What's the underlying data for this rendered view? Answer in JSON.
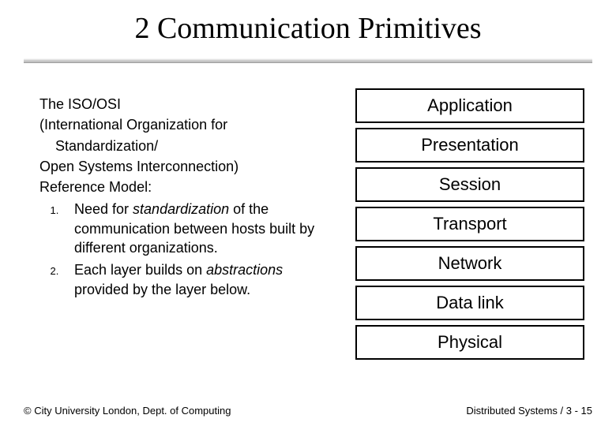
{
  "title": "2 Communication Primitives",
  "left": {
    "line1": "The ISO/OSI",
    "line2": "(International Organization for",
    "line3": "Standardization/",
    "line4": "Open Systems Interconnection)",
    "line5": "Reference Model:",
    "item1_pre": "Need for ",
    "item1_em": "standardization",
    "item1_post": " of the communication between hosts built by different organizations.",
    "item2_pre": "Each layer builds on ",
    "item2_em": "abstractions",
    "item2_post": " provided by the layer below."
  },
  "layers": {
    "l1": "Application",
    "l2": "Presentation",
    "l3": "Session",
    "l4": "Transport",
    "l5": "Network",
    "l6": "Data link",
    "l7": "Physical"
  },
  "footer": {
    "left": "© City University London, Dept. of Computing",
    "right": "Distributed Systems / 3 - 15"
  }
}
